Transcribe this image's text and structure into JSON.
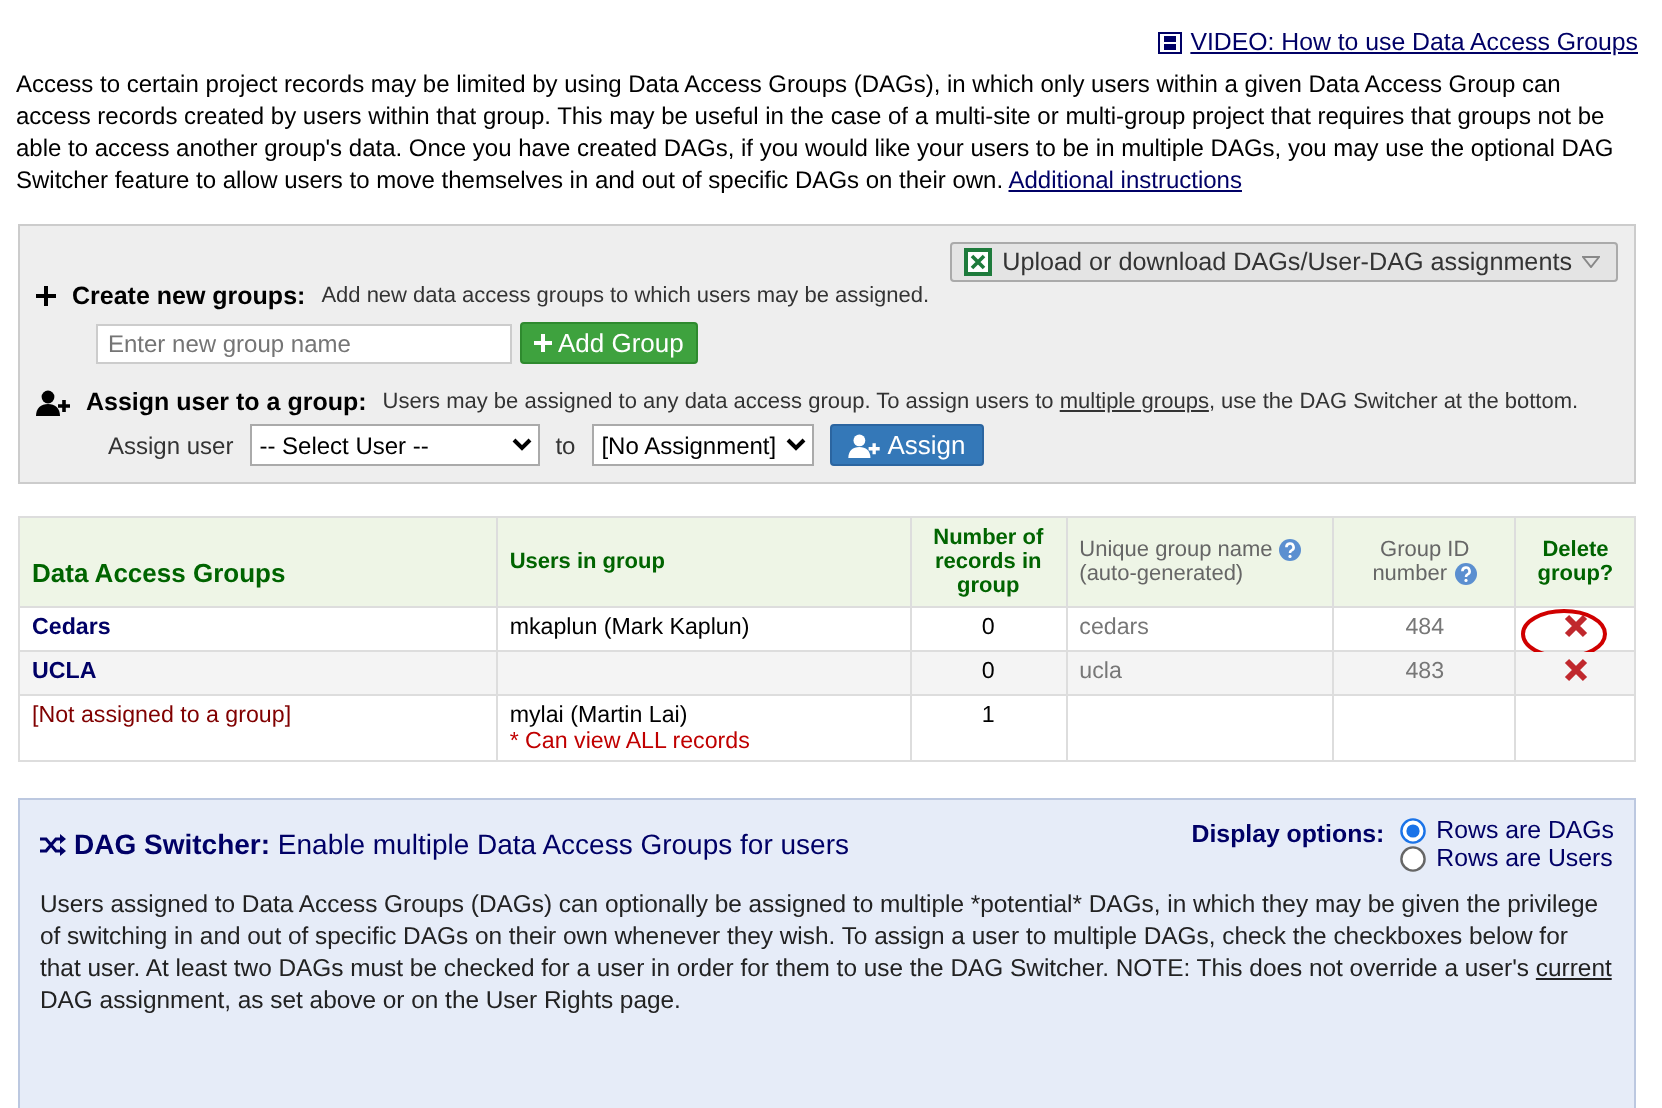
{
  "video_link": "VIDEO: How to use Data Access Groups",
  "intro": {
    "text": "Access to certain project records may be limited by using Data Access Groups (DAGs), in which only users within a given Data Access Group can access records created by users within that group. This may be useful in the case of a multi-site or multi-group project that requires that groups not be able to access another group's data. Once you have created DAGs, if you would like your users to be in multiple DAGs, you may use the optional DAG Switcher feature to allow users to move themselves in and out of specific DAGs on their own.",
    "link": "Additional instructions"
  },
  "upload_button": "Upload or download DAGs/User-DAG assignments",
  "create": {
    "title": "Create new groups:",
    "description": "Add new data access groups to which users may be assigned.",
    "placeholder": "Enter new group name",
    "button": "Add Group"
  },
  "assign": {
    "title": "Assign user to a group:",
    "description_before": "Users may be assigned to any data access group. To assign users to",
    "link": "multiple groups",
    "description_after": ", use the DAG Switcher at the bottom.",
    "label": "Assign user",
    "user_select": "-- Select User --",
    "to": "to",
    "group_select": "[No Assignment]",
    "button": "Assign"
  },
  "table": {
    "columns": [
      {
        "label": "Data Access Groups",
        "help": false
      },
      {
        "label": "Users in group",
        "help": false
      },
      {
        "label": "Number of records in group",
        "help": false
      },
      {
        "label": "Unique group name",
        "sub": "(auto-generated)",
        "help": true
      },
      {
        "label": "Group ID number",
        "help": true
      },
      {
        "label": "Delete group?",
        "help": false
      }
    ],
    "rows": [
      {
        "kind": "group",
        "name": "Cedars",
        "users": [
          "mkaplun (Mark Kaplun)"
        ],
        "records": "0",
        "unique_name": "cedars",
        "group_id": "484",
        "deletable": true,
        "circled": true
      },
      {
        "kind": "group",
        "name": "UCLA",
        "records": "0",
        "unique_name": "ucla",
        "group_id": "483",
        "deletable": true,
        "circled": false
      },
      {
        "kind": "unassigned",
        "name": "[Not assigned to a group]",
        "users": [
          "mylai (Martin Lai)"
        ],
        "note": "* Can view ALL records",
        "records": "1",
        "deletable": false,
        "circled": false
      }
    ]
  },
  "switcher": {
    "title_bold": "DAG Switcher:",
    "title": "Enable multiple Data Access Groups for users",
    "options_label": "Display options:",
    "options": [
      {
        "label": "Rows are DAGs",
        "selected": true
      },
      {
        "label": "Rows are Users",
        "selected": false
      }
    ],
    "description_before": "Users assigned to Data Access Groups (DAGs) can optionally be assigned to multiple *potential* DAGs, in which they may be given the privilege of switching in and out of specific DAGs on their own whenever they wish. To assign a user to multiple DAGs, check the checkboxes below for that user. At least two DAGs must be checked for a user in order for them to use the DAG Switcher. NOTE: This does not override a user's",
    "link": "current",
    "description_after": "DAG assignment, as set above or on the User Rights page."
  }
}
